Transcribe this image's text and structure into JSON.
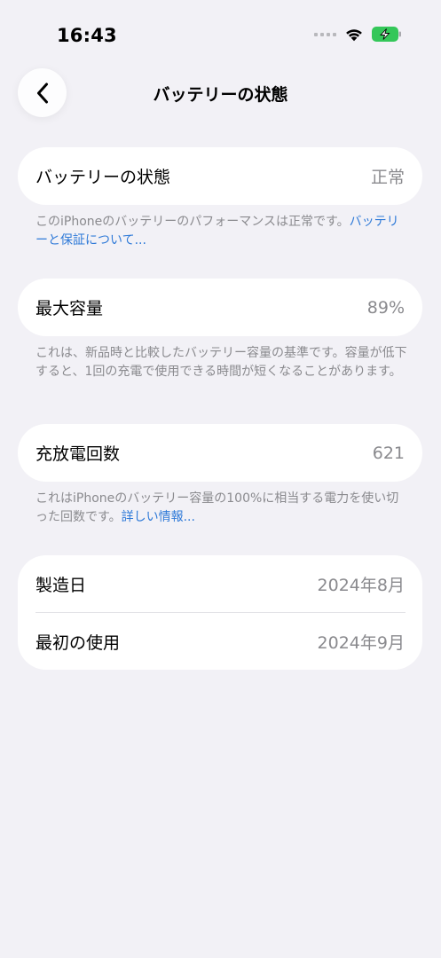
{
  "status_bar": {
    "time": "16:43"
  },
  "nav": {
    "title": "バッテリーの状態"
  },
  "battery_health": {
    "label": "バッテリーの状態",
    "value": "正常",
    "footnote_text": "このiPhoneのバッテリーのパフォーマンスは正常です。",
    "footnote_link": "バッテリーと保証について..."
  },
  "max_capacity": {
    "label": "最大容量",
    "value": "89%",
    "footnote_text": "これは、新品時と比較したバッテリー容量の基準です。容量が低下すると、1回の充電で使用できる時間が短くなることがあります。"
  },
  "cycle_count": {
    "label": "充放電回数",
    "value": "621",
    "footnote_text": "これはiPhoneのバッテリー容量の100%に相当する電力を使い切った回数です。",
    "footnote_link": "詳しい情報..."
  },
  "dates": {
    "manufacture_label": "製造日",
    "manufacture_value": "2024年8月",
    "first_use_label": "最初の使用",
    "first_use_value": "2024年9月"
  },
  "colors": {
    "accent": "#2f7ad8",
    "battery_green": "#34c759",
    "background": "#f2f1f6"
  },
  "icons": [
    "wifi-icon",
    "battery-charging-icon",
    "chevron-left-icon"
  ]
}
